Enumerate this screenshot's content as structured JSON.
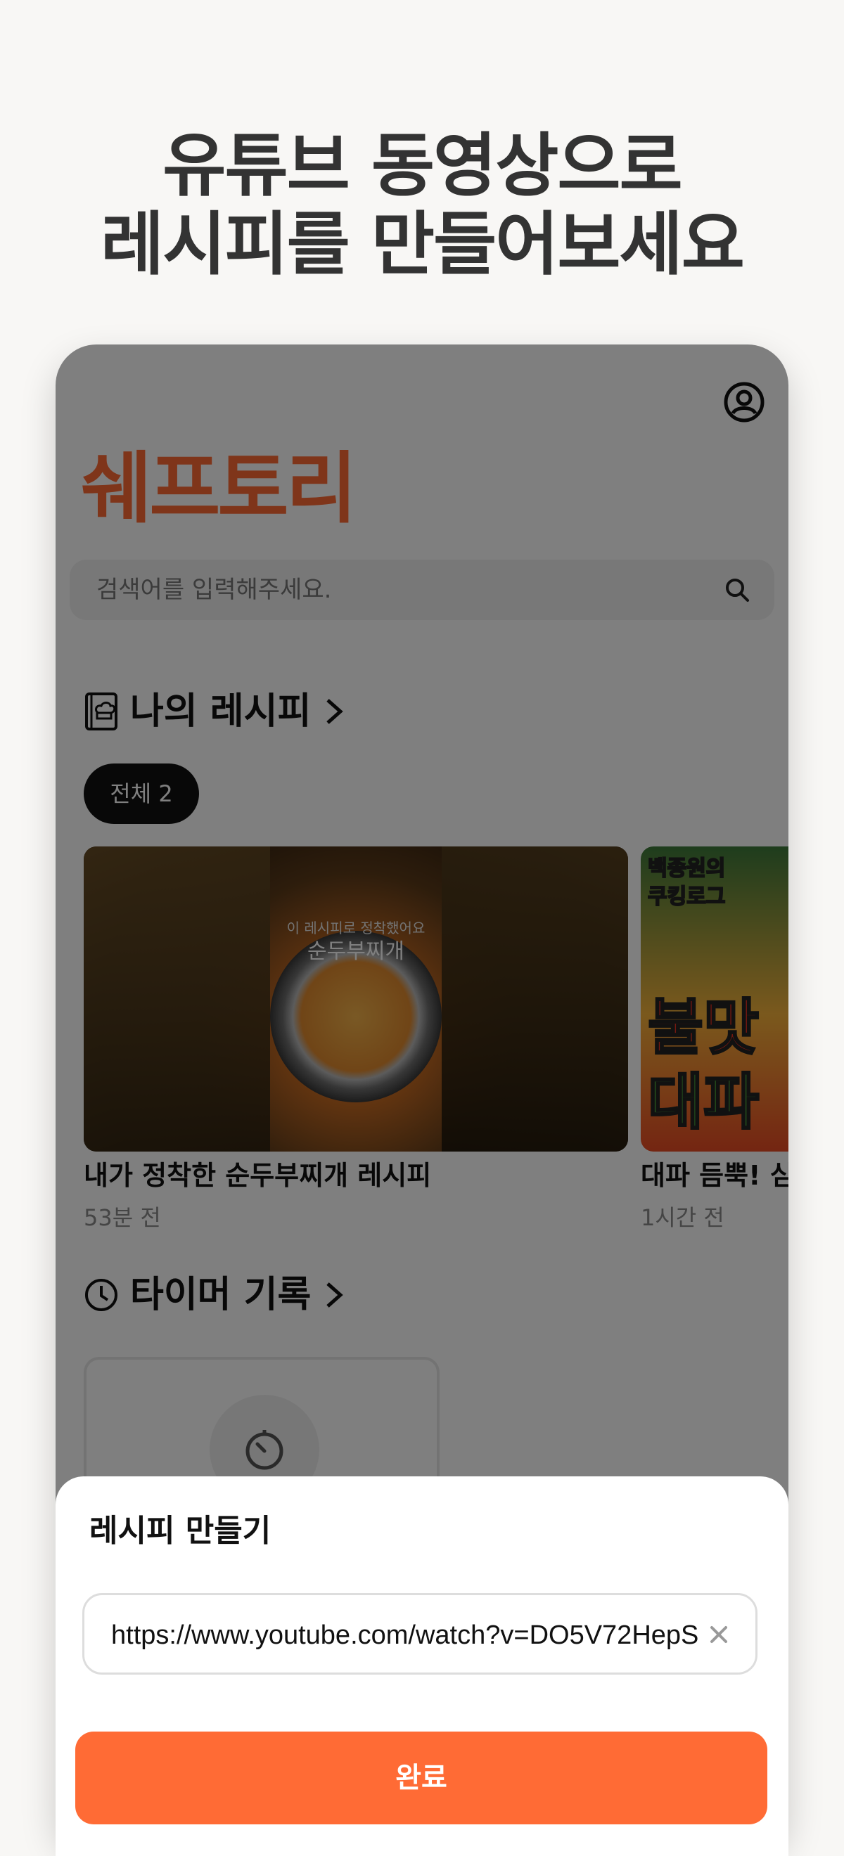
{
  "headline": {
    "line1": "유튜브 동영상으로",
    "line2": "레시피를 만들어보세요"
  },
  "app": {
    "logo": "쉐프토리",
    "search": {
      "placeholder": "검색어를 입력해주세요."
    },
    "my_recipes": {
      "title": "나의 레시피",
      "filter": "전체 2",
      "cards": [
        {
          "title": "내가 정착한 순두부찌개 레시피",
          "time": "53분 전",
          "thumb_caption_small": "이 레시피로 정착했어요",
          "thumb_caption": "순두부찌개"
        },
        {
          "title": "대파 듬뿍! 심",
          "time": "1시간 전",
          "thumb_text1": "백종원의",
          "thumb_text2": "쿠킹로그",
          "thumb_big1": "불맛",
          "thumb_big2": "대파"
        }
      ]
    },
    "timer_history": {
      "title": "타이머 기록"
    }
  },
  "sheet": {
    "title": "레시피 만들기",
    "url_value": "https://www.youtube.com/watch?v=DO5V72HepS",
    "done_label": "완료"
  },
  "colors": {
    "accent": "#ff6b35",
    "headline": "#333333",
    "page_bg": "#f8f7f5"
  }
}
